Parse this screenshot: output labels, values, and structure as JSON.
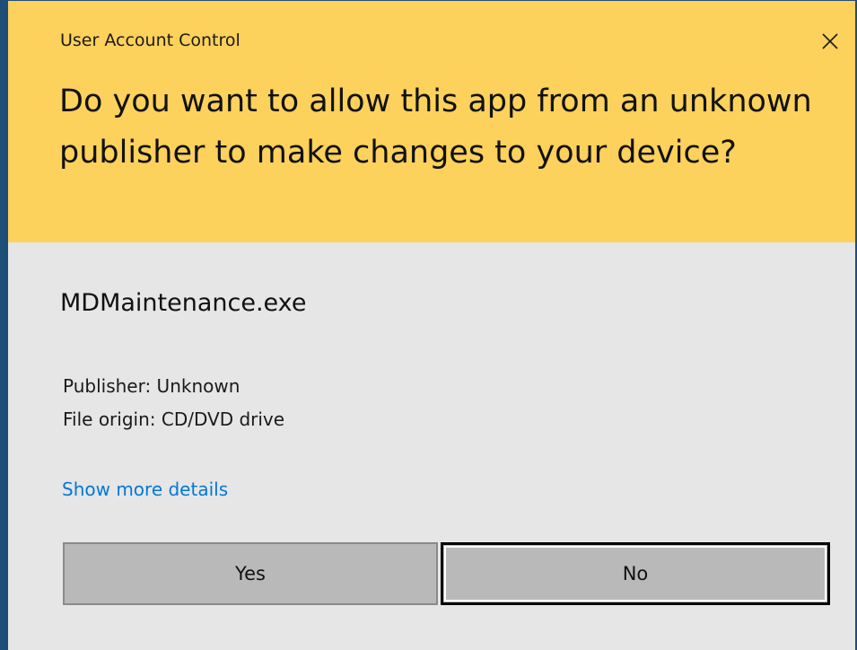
{
  "dialog": {
    "title": "User Account Control",
    "question": "Do you want to allow this app from an unknown publisher to make changes to your device?",
    "app_name": "MDMaintenance.exe",
    "publisher_line": "Publisher: Unknown",
    "origin_line": "File origin: CD/DVD drive",
    "more_details_link": "Show more details",
    "yes_label": "Yes",
    "no_label": "No",
    "close_icon": "close-icon"
  },
  "colors": {
    "header_bg": "#fcd15c",
    "body_bg": "#e6e6e6",
    "link": "#0078d7",
    "button_bg": "#b9b9b9",
    "frame": "#1f4e79"
  }
}
